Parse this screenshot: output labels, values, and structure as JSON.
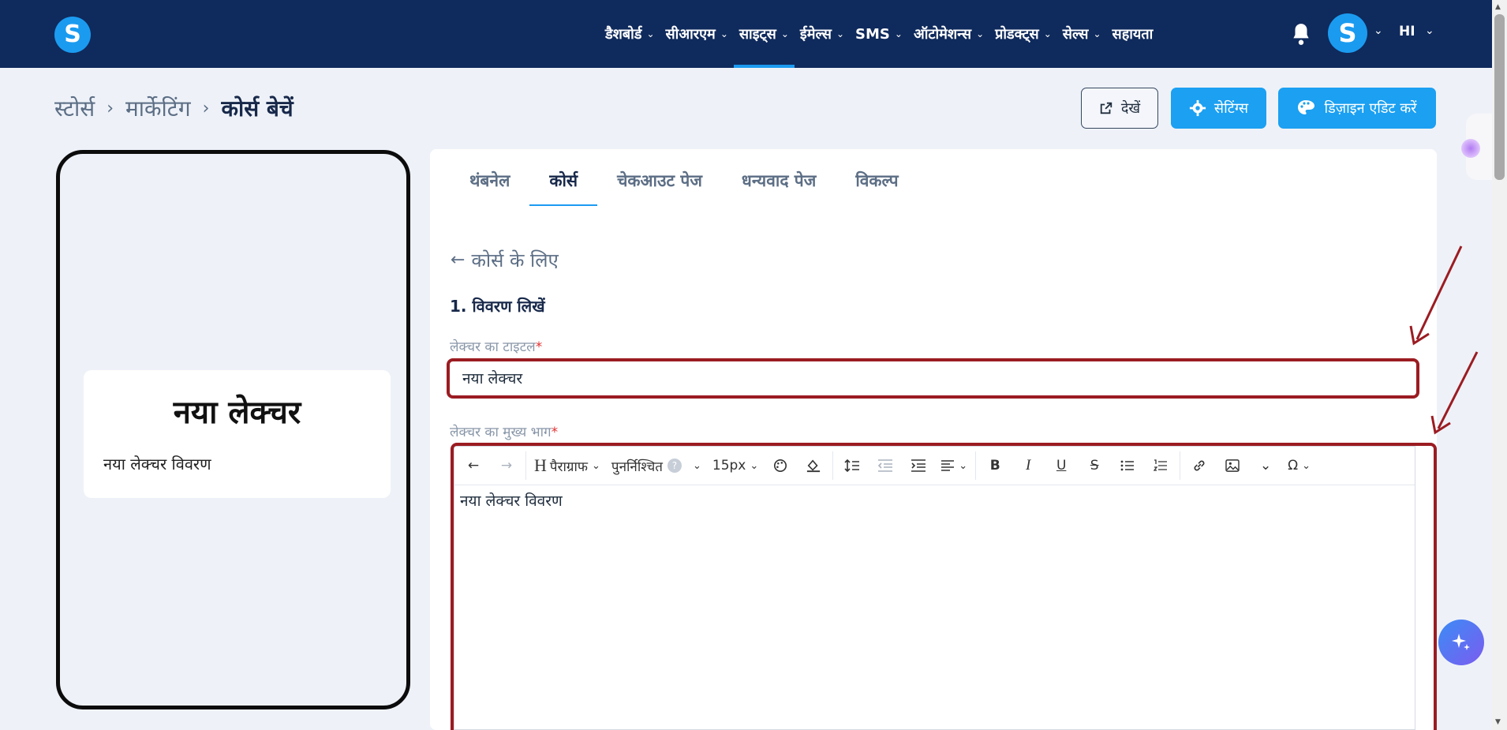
{
  "nav": {
    "logo": "S",
    "items": [
      {
        "label": "डैशबोर्ड",
        "dropdown": true,
        "active": false
      },
      {
        "label": "सीआरएम",
        "dropdown": true,
        "active": false
      },
      {
        "label": "साइट्स",
        "dropdown": true,
        "active": true
      },
      {
        "label": "ईमेल्स",
        "dropdown": true,
        "active": false
      },
      {
        "label": "SMS",
        "dropdown": true,
        "active": false
      },
      {
        "label": "ऑटोमेशन्स",
        "dropdown": true,
        "active": false
      },
      {
        "label": "प्रोडक्ट्स",
        "dropdown": true,
        "active": false
      },
      {
        "label": "सेल्स",
        "dropdown": true,
        "active": false
      },
      {
        "label": "सहायता",
        "dropdown": false,
        "active": false
      }
    ],
    "avatar": "S",
    "language": "HI"
  },
  "breadcrumb": {
    "items": [
      "स्टोर्स",
      "मार्केटिंग"
    ],
    "current": "कोर्स बेचें"
  },
  "actions": {
    "view": "देखें",
    "settings": "सेटिंग्स",
    "design": "डिज़ाइन एडिट करें"
  },
  "preview": {
    "title": "नया लेक्चर",
    "description": "नया लेक्चर विवरण"
  },
  "tabs": [
    {
      "label": "थंबनेल",
      "active": false
    },
    {
      "label": "कोर्स",
      "active": true
    },
    {
      "label": "चेकआउट पेज",
      "active": false
    },
    {
      "label": "धन्यवाद पेज",
      "active": false
    },
    {
      "label": "विकल्प",
      "active": false
    }
  ],
  "form": {
    "back_label": "कोर्स के लिए",
    "section_title": "1. विवरण लिखें",
    "title_label": "लेक्चर का टाइटल",
    "title_value": "नया लेक्चर",
    "body_label": "लेक्चर का मुख्य भाग",
    "body_value": "नया लेक्चर विवरण",
    "required_mark": "*"
  },
  "toolbar": {
    "heading_letter": "H",
    "block_format": "पैराग्राफ",
    "font_family": "पुनर्निश्चित",
    "font_size": "15px",
    "help": "?"
  },
  "colors": {
    "nav_bg": "#0f2a5c",
    "accent": "#1b9bf0",
    "annotation": "#9b1c22"
  }
}
